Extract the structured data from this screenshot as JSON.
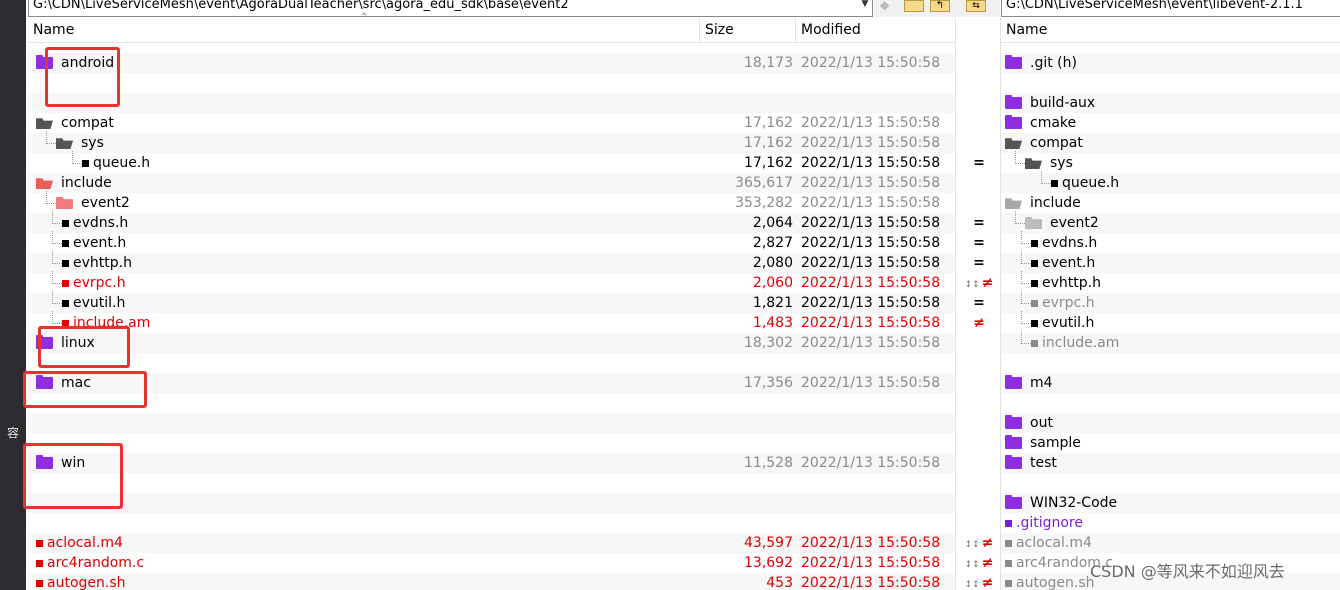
{
  "sidebar": {
    "glyph": "容"
  },
  "left_panel": {
    "path": "G:\\CDN\\LiveServiceMesh\\event\\AgoraDualTeacher\\src\\agora_edu_sdk\\base\\event2",
    "columns": {
      "name": "Name",
      "size": "Size",
      "modified": "Modified"
    },
    "rows": [
      {
        "name": "android",
        "size": "18,173",
        "date": "2022/1/13 15:50:58",
        "icon": "f-purple",
        "style": "muted",
        "depth": 0
      },
      {
        "name": "",
        "size": "",
        "date": "",
        "icon": "",
        "style": "",
        "depth": 0
      },
      {
        "name": "",
        "size": "",
        "date": "",
        "icon": "",
        "style": "",
        "depth": 0
      },
      {
        "name": "compat",
        "size": "17,162",
        "date": "2022/1/13 15:50:58",
        "icon": "f-open-dark",
        "style": "muted",
        "depth": 0
      },
      {
        "name": "sys",
        "size": "17,162",
        "date": "2022/1/13 15:50:58",
        "icon": "f-open-dark",
        "style": "muted",
        "depth": 1
      },
      {
        "name": "queue.h",
        "size": "17,162",
        "date": "2022/1/13 15:50:58",
        "icon": "sq-black",
        "style": "",
        "depth": 2
      },
      {
        "name": "include",
        "size": "365,617",
        "date": "2022/1/13 15:50:58",
        "icon": "f-open-salmon",
        "style": "muted",
        "depth": 0
      },
      {
        "name": "event2",
        "size": "353,282",
        "date": "2022/1/13 15:50:58",
        "icon": "f-salmon",
        "style": "muted",
        "depth": 1
      },
      {
        "name": "evdns.h",
        "size": "2,064",
        "date": "2022/1/13 15:50:58",
        "icon": "sq-black",
        "style": "",
        "depth": 1
      },
      {
        "name": "event.h",
        "size": "2,827",
        "date": "2022/1/13 15:50:58",
        "icon": "sq-black",
        "style": "",
        "depth": 1
      },
      {
        "name": "evhttp.h",
        "size": "2,080",
        "date": "2022/1/13 15:50:58",
        "icon": "sq-black",
        "style": "",
        "depth": 1
      },
      {
        "name": "evrpc.h",
        "size": "2,060",
        "date": "2022/1/13 15:50:58",
        "icon": "sq-red",
        "style": "red",
        "depth": 1
      },
      {
        "name": "evutil.h",
        "size": "1,821",
        "date": "2022/1/13 15:50:58",
        "icon": "sq-black",
        "style": "",
        "depth": 1
      },
      {
        "name": "include.am",
        "size": "1,483",
        "date": "2022/1/13 15:50:58",
        "icon": "sq-red",
        "style": "red",
        "depth": 1
      },
      {
        "name": "linux",
        "size": "18,302",
        "date": "2022/1/13 15:50:58",
        "icon": "f-purple",
        "style": "muted",
        "depth": 0
      },
      {
        "name": "",
        "size": "",
        "date": "",
        "icon": "",
        "style": "",
        "depth": 0
      },
      {
        "name": "mac",
        "size": "17,356",
        "date": "2022/1/13 15:50:58",
        "icon": "f-purple",
        "style": "muted",
        "depth": 0
      },
      {
        "name": "",
        "size": "",
        "date": "",
        "icon": "",
        "style": "",
        "depth": 0
      },
      {
        "name": "",
        "size": "",
        "date": "",
        "icon": "",
        "style": "",
        "depth": 0
      },
      {
        "name": "",
        "size": "",
        "date": "",
        "icon": "",
        "style": "",
        "depth": 0
      },
      {
        "name": "win",
        "size": "11,528",
        "date": "2022/1/13 15:50:58",
        "icon": "f-purple",
        "style": "muted",
        "depth": 0
      },
      {
        "name": "",
        "size": "",
        "date": "",
        "icon": "",
        "style": "",
        "depth": 0
      },
      {
        "name": "",
        "size": "",
        "date": "",
        "icon": "",
        "style": "",
        "depth": 0
      },
      {
        "name": "",
        "size": "",
        "date": "",
        "icon": "",
        "style": "",
        "depth": 0
      },
      {
        "name": "aclocal.m4",
        "size": "43,597",
        "date": "2022/1/13 15:50:58",
        "icon": "sq-red",
        "style": "red",
        "depth": 0
      },
      {
        "name": "arc4random.c",
        "size": "13,692",
        "date": "2022/1/13 15:50:58",
        "icon": "sq-red",
        "style": "red",
        "depth": 0
      },
      {
        "name": "autogen.sh",
        "size": "453",
        "date": "2022/1/13 15:50:58",
        "icon": "sq-red",
        "style": "red",
        "depth": 0
      }
    ]
  },
  "right_panel": {
    "path": "G:\\CDN\\LiveServiceMesh\\event\\libevent-2.1.1",
    "columns": {
      "name": "Name"
    },
    "rows": [
      {
        "name": ".git (h)",
        "icon": "f-purple",
        "style": "",
        "depth": 0
      },
      {
        "name": "",
        "icon": "",
        "style": "",
        "depth": 0
      },
      {
        "name": "build-aux",
        "icon": "f-purple",
        "style": "",
        "depth": 0
      },
      {
        "name": "cmake",
        "icon": "f-purple",
        "style": "",
        "depth": 0
      },
      {
        "name": "compat",
        "icon": "f-open-dark",
        "style": "",
        "depth": 0
      },
      {
        "name": "sys",
        "icon": "f-open-dark",
        "style": "",
        "depth": 1
      },
      {
        "name": "queue.h",
        "icon": "sq-black",
        "style": "",
        "depth": 2
      },
      {
        "name": "include",
        "icon": "f-open-gray",
        "style": "",
        "depth": 0
      },
      {
        "name": "event2",
        "icon": "f-gray",
        "style": "",
        "depth": 1
      },
      {
        "name": "evdns.h",
        "icon": "sq-black",
        "style": "",
        "depth": 1
      },
      {
        "name": "event.h",
        "icon": "sq-black",
        "style": "",
        "depth": 1
      },
      {
        "name": "evhttp.h",
        "icon": "sq-black",
        "style": "",
        "depth": 1
      },
      {
        "name": "evrpc.h",
        "icon": "sq-gray",
        "style": "gray-text",
        "depth": 1
      },
      {
        "name": "evutil.h",
        "icon": "sq-black",
        "style": "",
        "depth": 1
      },
      {
        "name": "include.am",
        "icon": "sq-gray",
        "style": "gray-text",
        "depth": 1
      },
      {
        "name": "",
        "icon": "",
        "style": "",
        "depth": 0
      },
      {
        "name": "m4",
        "icon": "f-purple",
        "style": "",
        "depth": 0
      },
      {
        "name": "",
        "icon": "",
        "style": "",
        "depth": 0
      },
      {
        "name": "out",
        "icon": "f-purple",
        "style": "",
        "depth": 0
      },
      {
        "name": "sample",
        "icon": "f-purple",
        "style": "",
        "depth": 0
      },
      {
        "name": "test",
        "icon": "f-purple",
        "style": "",
        "depth": 0
      },
      {
        "name": "",
        "icon": "",
        "style": "",
        "depth": 0
      },
      {
        "name": "WIN32-Code",
        "icon": "f-purple",
        "style": "",
        "depth": 0
      },
      {
        "name": ".gitignore",
        "icon": "sq-purple",
        "style": "purple-text",
        "depth": 0
      },
      {
        "name": "aclocal.m4",
        "icon": "sq-gray",
        "style": "gray-text",
        "depth": 0
      },
      {
        "name": "arc4random.c",
        "icon": "sq-gray",
        "style": "gray-text",
        "depth": 0
      },
      {
        "name": "autogen.sh",
        "icon": "sq-gray",
        "style": "gray-text",
        "depth": 0
      }
    ]
  },
  "gutter_marks": [
    {
      "row": 5,
      "mark": "=",
      "style": ""
    },
    {
      "row": 8,
      "mark": "=",
      "style": ""
    },
    {
      "row": 9,
      "mark": "=",
      "style": ""
    },
    {
      "row": 10,
      "mark": "=",
      "style": ""
    },
    {
      "row": 11,
      "mark": "≠",
      "style": "red",
      "mini": "↕↕"
    },
    {
      "row": 12,
      "mark": "=",
      "style": ""
    },
    {
      "row": 13,
      "mark": "≠",
      "style": "red",
      "mini": ""
    },
    {
      "row": 24,
      "mark": "≠",
      "style": "red",
      "mini": "↕↕"
    },
    {
      "row": 25,
      "mark": "≠",
      "style": "red",
      "mini": "↕↕"
    },
    {
      "row": 26,
      "mark": "≠",
      "style": "red",
      "mini": "↕↕"
    }
  ],
  "watermark": "CSDN @等风来不如迎风去",
  "colors": {
    "annotation": "#e8322b",
    "folder_purple": "#8e2de2",
    "diff_red": "#e00000"
  }
}
